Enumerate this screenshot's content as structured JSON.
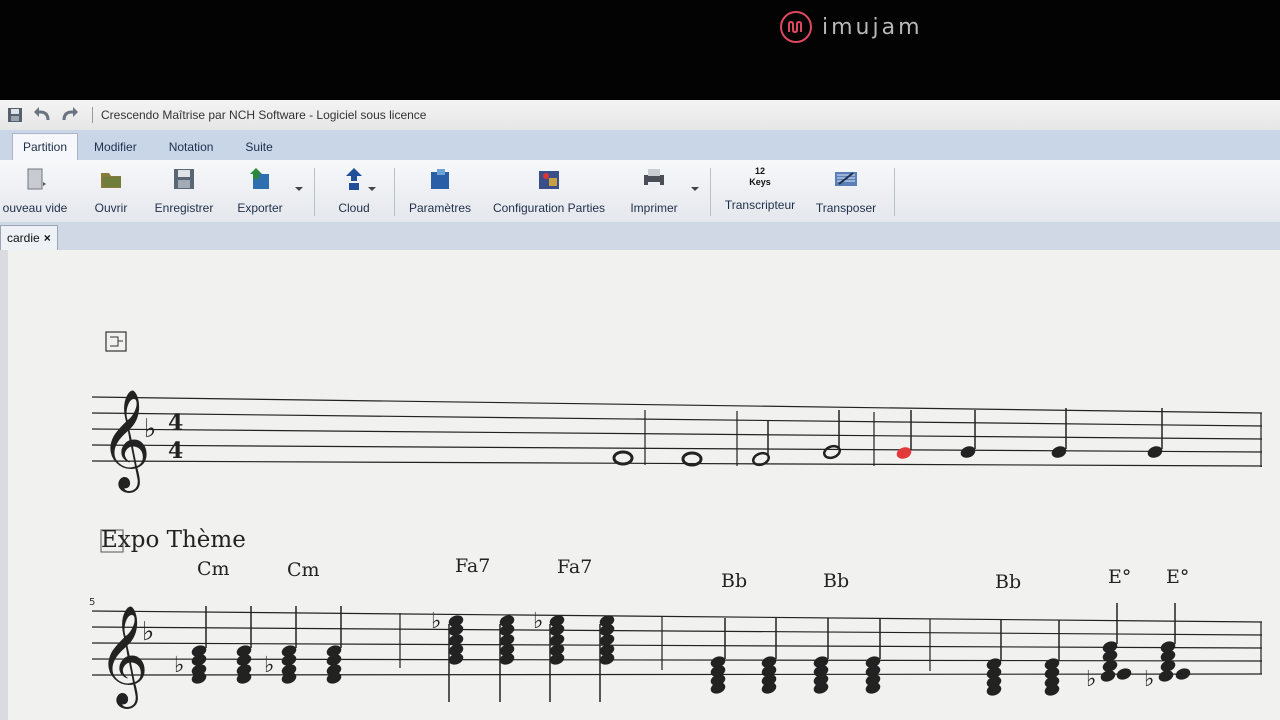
{
  "watermark": {
    "text": "imujam",
    "accent": "#e0485f"
  },
  "window": {
    "title": "Crescendo Maîtrise par NCH Software - Logiciel sous licence"
  },
  "ribbon_tabs": [
    {
      "label": "Partition",
      "active": true
    },
    {
      "label": "Modifier"
    },
    {
      "label": "Notation"
    },
    {
      "label": "Suite"
    }
  ],
  "toolbar": {
    "new": "ouveau vide",
    "open": "Ouvrir",
    "save": "Enregistrer",
    "export": "Exporter",
    "cloud": "Cloud",
    "settings": "Paramètres",
    "parts": "Configuration Parties",
    "print": "Imprimer",
    "transcriber": "Transcripteur",
    "transcriber_icon_text": "12 Keys",
    "transpose": "Transposer"
  },
  "doc_tab": {
    "label": "cardie",
    "close": "×"
  },
  "score": {
    "section_label": "Expo Thème",
    "measure_number_2": "5",
    "chords": [
      "Cm",
      "Cm",
      "Fa7",
      "Fa7",
      "Bb",
      "Bb",
      "Bb",
      "E°",
      "E°"
    ],
    "time_signature": {
      "top": "4",
      "bottom": "4"
    },
    "highlight_color": "#e23a3a"
  }
}
